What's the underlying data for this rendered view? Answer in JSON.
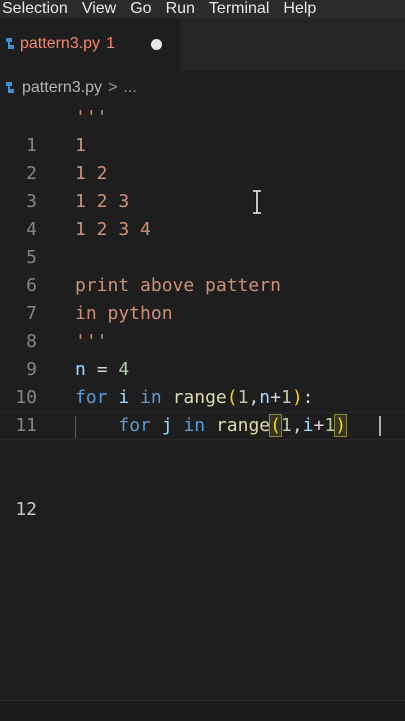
{
  "menu": [
    "Selection",
    "View",
    "Go",
    "Run",
    "Terminal",
    "Help"
  ],
  "tab": {
    "label": "pattern3.py",
    "problem_count": "1",
    "file_icon": "python-icon"
  },
  "breadcrumb": {
    "file": "pattern3.py",
    "separator": ">",
    "more": "..."
  },
  "editor": {
    "active_line": 12,
    "lines": [
      {
        "n": "1",
        "text": "'''"
      },
      {
        "n": "2",
        "text": "1"
      },
      {
        "n": "3",
        "text": "1 2"
      },
      {
        "n": "4",
        "text": "1 2 3"
      },
      {
        "n": "5",
        "text": "1 2 3 4"
      },
      {
        "n": "6",
        "text": ""
      },
      {
        "n": "7",
        "text": "print above pattern"
      },
      {
        "n": "8",
        "text": "in python"
      },
      {
        "n": "9",
        "text": "'''"
      },
      {
        "n": "10",
        "text": "n = 4"
      },
      {
        "n": "11",
        "text": "for i in range(1,n+1):"
      },
      {
        "n": "12",
        "text": "    for j in range(1,i+1)"
      }
    ]
  },
  "colors": {
    "background": "#1e1e1e",
    "string": "#ce9178",
    "keyword": "#569cd6",
    "function": "#dcdcaa",
    "number": "#b5cea8",
    "variable": "#9cdcfe"
  }
}
